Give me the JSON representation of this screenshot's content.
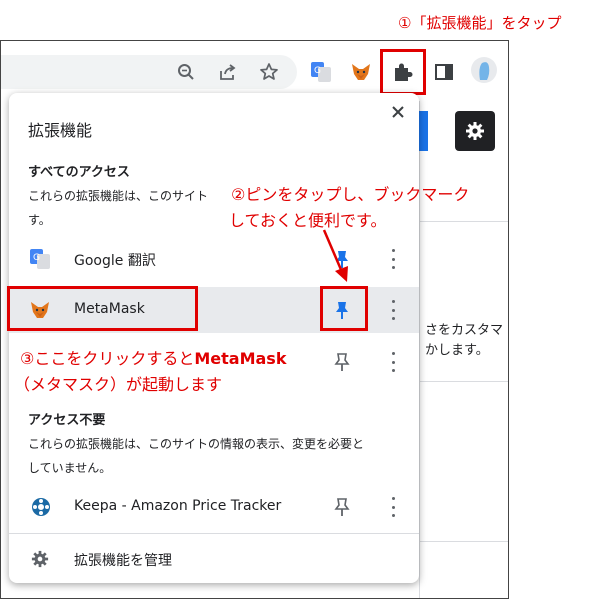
{
  "annotations": {
    "step1": "①「拡張機能」をタップ",
    "step2_line1": "②ピンをタップし、ブックマーク",
    "step2_line2": "しておくと便利です。",
    "step3_prefix": "③ここをクリックすると",
    "step3_bold": "MetaMask",
    "step3_line2": "（メタマスク）が起動します"
  },
  "background_page": {
    "text_line1": "さをカスタマ",
    "text_line2": "かします。"
  },
  "popup": {
    "title": "拡張機能",
    "section_full_access": {
      "heading": "すべてのアクセス",
      "description_line1": "これらの拡張機能は、このサイト",
      "description_line2": "す。"
    },
    "extensions_full": [
      {
        "name": "Google 翻訳",
        "icon": "google-translate-icon",
        "pinned": false
      },
      {
        "name": "MetaMask",
        "icon": "metamask-fox-icon",
        "pinned": true
      },
      {
        "name": "",
        "icon": "",
        "pinned": false
      }
    ],
    "section_no_access": {
      "heading": "アクセス不要",
      "description_line1": "これらの拡張機能は、このサイトの情報の表示、変更を必要と",
      "description_line2": "していません。"
    },
    "extensions_no_access": [
      {
        "name": "Keepa - Amazon Price Tracker",
        "icon": "keepa-icon",
        "pinned": false
      }
    ],
    "manage_label": "拡張機能を管理"
  },
  "colors": {
    "annotation_red": "#e00000",
    "pin_blue": "#1a73e8",
    "selected_row": "#e8eaed",
    "metamask_orange": "#e2761b"
  }
}
